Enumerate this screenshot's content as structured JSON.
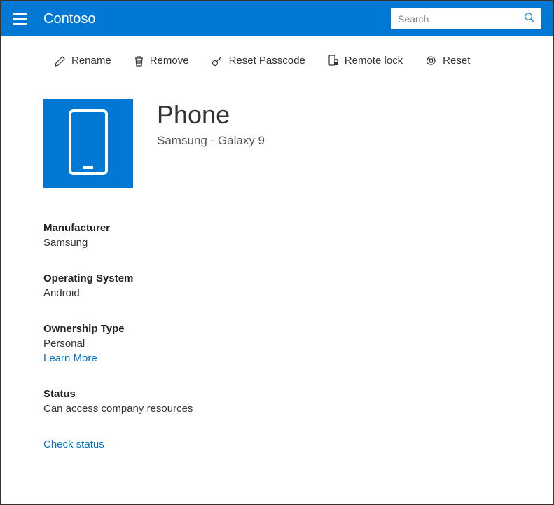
{
  "brand": "Contoso",
  "search": {
    "placeholder": "Search"
  },
  "toolbar": {
    "rename": "Rename",
    "remove": "Remove",
    "reset_passcode": "Reset Passcode",
    "remote_lock": "Remote lock",
    "reset": "Reset"
  },
  "device": {
    "title": "Phone",
    "subtitle": "Samsung - Galaxy 9"
  },
  "details": {
    "manufacturer": {
      "label": "Manufacturer",
      "value": "Samsung"
    },
    "operating_system": {
      "label": "Operating System",
      "value": "Android"
    },
    "ownership_type": {
      "label": "Ownership Type",
      "value": "Personal",
      "link": "Learn More"
    },
    "status": {
      "label": "Status",
      "value": "Can access company resources"
    },
    "check_status": "Check status"
  }
}
